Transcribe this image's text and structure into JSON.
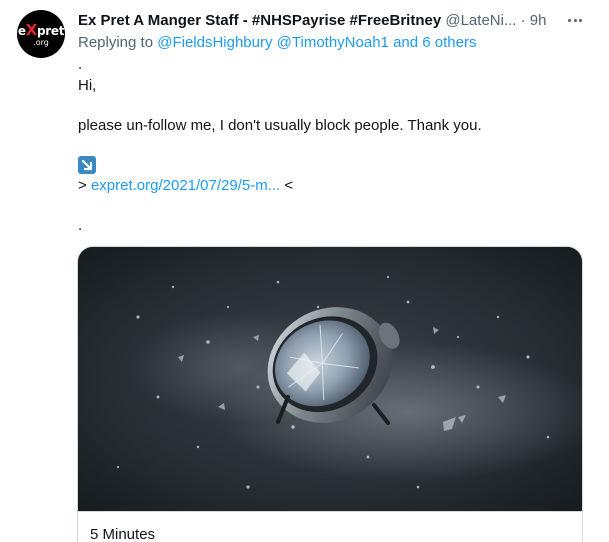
{
  "tweet": {
    "avatar": {
      "logo_main_prefix": "e",
      "logo_main_x": "X",
      "logo_main_suffix": "pret",
      "logo_sub": ".org"
    },
    "author_name": "Ex Pret A Manger Staff - #NHSPayrise #FreeBritney",
    "handle": "@LateNi...",
    "separator": "·",
    "time": "9h",
    "reply": {
      "prefix": "Replying to",
      "mention_1": "@FieldsHighbury",
      "mention_2": "@TimothyNoah1",
      "others": "and 6 others"
    },
    "body": {
      "line_dot_1": ".",
      "greeting": "Hi,",
      "message": "please un-follow me, I don't usually block people. Thank you.",
      "arrow_icon": "down-right-arrow-icon",
      "link_prefix": ">",
      "link_text": "expret.org/2021/07/29/5-m...",
      "link_suffix": "<",
      "line_dot_2": "."
    },
    "card": {
      "title": "5 Minutes",
      "media_icon": "exploding-alarm-clock-image"
    }
  },
  "colors": {
    "link": "#1d9bf0",
    "muted": "#536471",
    "text": "#0f1419",
    "border": "#cfd9de",
    "emoji_bg": "#3b88c3"
  }
}
